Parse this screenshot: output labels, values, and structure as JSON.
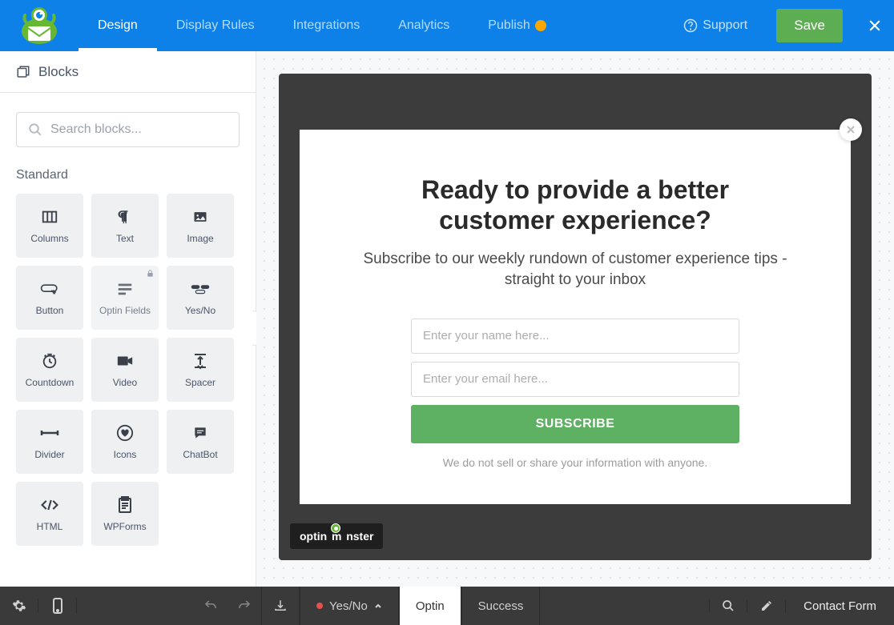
{
  "topnav": {
    "tabs": [
      "Design",
      "Display Rules",
      "Integrations",
      "Analytics",
      "Publish"
    ],
    "active_tab": 0,
    "support": "Support",
    "save": "Save"
  },
  "sidebar": {
    "header": "Blocks",
    "search_placeholder": "Search blocks...",
    "section": "Standard",
    "blocks": [
      {
        "label": "Columns",
        "icon": "columns"
      },
      {
        "label": "Text",
        "icon": "paragraph"
      },
      {
        "label": "Image",
        "icon": "image"
      },
      {
        "label": "Button",
        "icon": "button"
      },
      {
        "label": "Optin Fields",
        "icon": "fields",
        "locked": true
      },
      {
        "label": "Yes/No",
        "icon": "yesno"
      },
      {
        "label": "Countdown",
        "icon": "clock"
      },
      {
        "label": "Video",
        "icon": "video"
      },
      {
        "label": "Spacer",
        "icon": "spacer"
      },
      {
        "label": "Divider",
        "icon": "divider"
      },
      {
        "label": "Icons",
        "icon": "hearticon"
      },
      {
        "label": "ChatBot",
        "icon": "chat"
      },
      {
        "label": "HTML",
        "icon": "code"
      },
      {
        "label": "WPForms",
        "icon": "form"
      }
    ]
  },
  "popup": {
    "title_l1": "Ready to provide a better",
    "title_l2": "customer experience?",
    "subtitle": "Subscribe to our weekly rundown of customer experience tips - straight to your inbox",
    "name_placeholder": "Enter your name here...",
    "email_placeholder": "Enter your email here...",
    "button": "SUBSCRIBE",
    "fineprint": "We do not sell or share your information with anyone.",
    "badge_pre": "optin",
    "badge_post": "nster"
  },
  "bottombar": {
    "tabs": [
      {
        "label": "Yes/No",
        "has_dot": true,
        "has_chevron": true
      },
      {
        "label": "Optin",
        "active": true
      },
      {
        "label": "Success"
      }
    ],
    "campaign_name": "Contact Form"
  },
  "colors": {
    "brand_blue": "#0D81E8",
    "accent_green": "#5DAE52",
    "subscribe_green": "#5EB063"
  }
}
